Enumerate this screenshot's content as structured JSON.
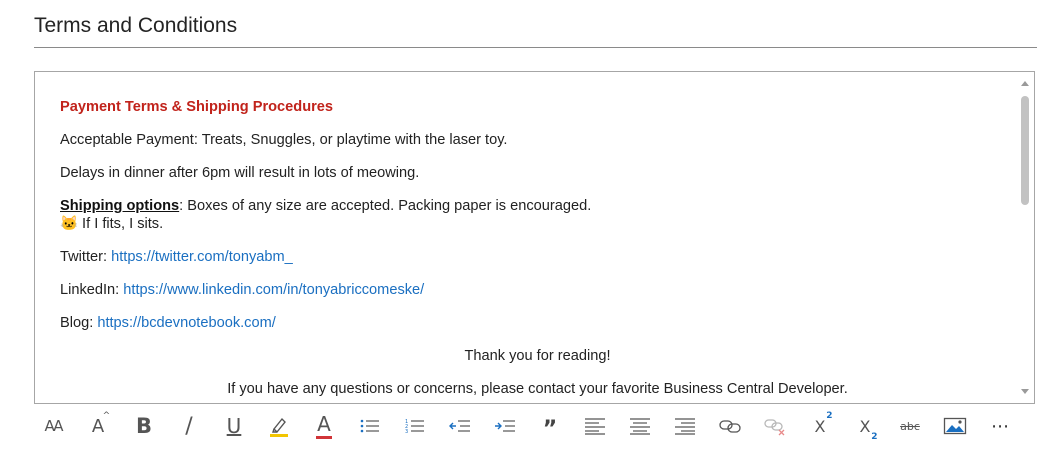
{
  "section": {
    "title": "Terms and Conditions"
  },
  "editor": {
    "heading": "Payment Terms & Shipping Procedures",
    "line_payment": "Acceptable Payment: Treats, Snuggles, or playtime with the laser toy.",
    "line_dinner": "Delays in dinner after 6pm will result in lots of meowing.",
    "shipping_label": "Shipping options",
    "shipping_text": ": Boxes of any size are accepted. Packing paper is encouraged.",
    "emoji": "🐱",
    "fits_text": " If I fits, I sits.",
    "twitter_label": "Twitter: ",
    "twitter_url": "https://twitter.com/tonyabm_",
    "linkedin_label": "LinkedIn: ",
    "linkedin_url": "https://www.linkedin.com/in/tonyabriccomeske/",
    "blog_label": "Blog: ",
    "blog_url": "https://bcdevnotebook.com/",
    "thanks": "Thank you for reading!",
    "contact": "If you have any questions or concerns, please contact your favorite Business Central Developer."
  },
  "toolbar": {
    "font_size_glyph": "AA",
    "grow_glyph": "A",
    "bold_glyph": "B",
    "italic_glyph": "/",
    "underline_glyph": "U",
    "font_color_glyph": "A",
    "quote_glyph": "”",
    "superscript_glyph": "X",
    "superscript_mark": "2",
    "subscript_glyph": "X",
    "subscript_mark": "2",
    "strike_glyph": "abc",
    "more_glyph": "⋯",
    "colors": {
      "highlight": "#f2c500",
      "font_color": "#d13438",
      "accent": "#1a6fc1"
    }
  }
}
